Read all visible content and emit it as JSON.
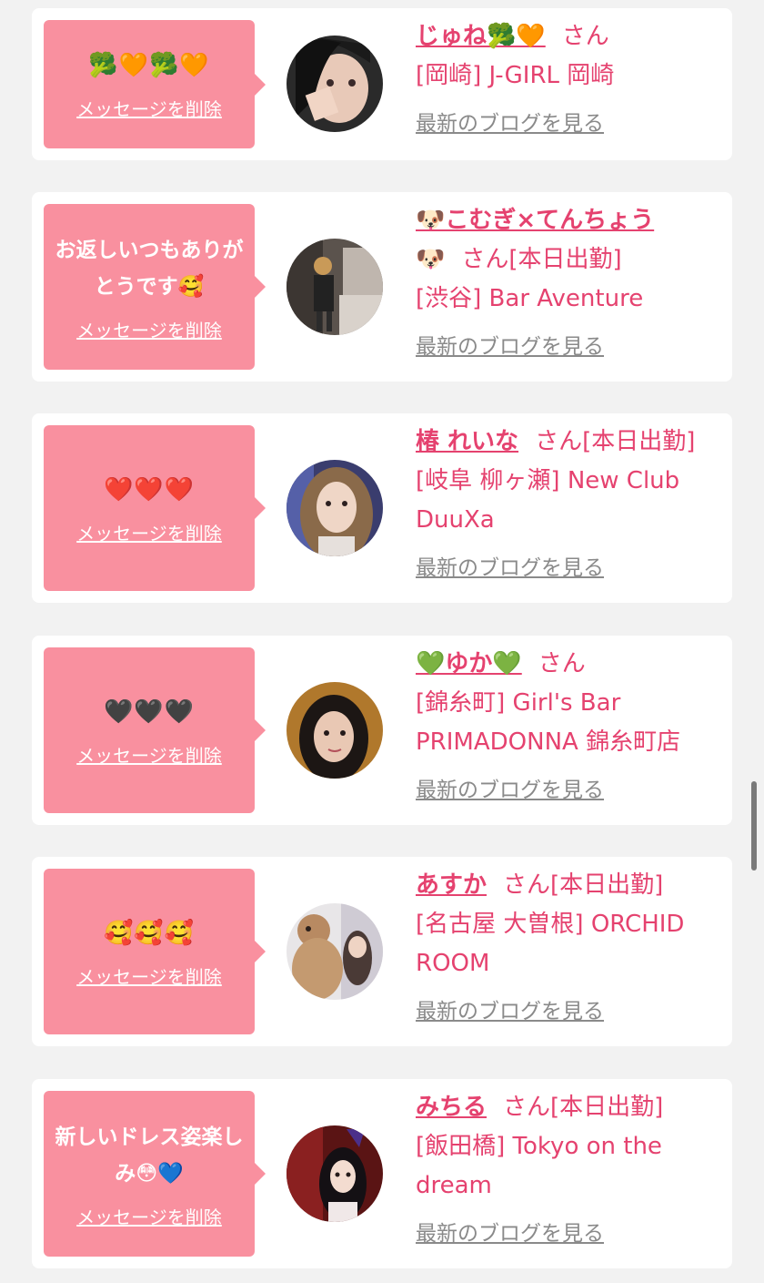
{
  "cards": [
    {
      "message": "🥦🧡🥦🧡",
      "delete_label": "メッセージを削除",
      "name": "じゅね🥦🧡",
      "suffix": "さん",
      "shop": "[岡崎] J-GIRL 岡崎",
      "blog_label": "最新のブログを見る",
      "avatar_icon": "avatar-photo"
    },
    {
      "message": "お返しいつもありがとうです🥰",
      "delete_label": "メッセージを削除",
      "name": "🐶こむぎ×てんちょう",
      "name_cont": "🐶",
      "suffix": "さん[本日出勤]",
      "shop": "[渋谷] Bar Aventure",
      "blog_label": "最新のブログを見る",
      "avatar_icon": "avatar-photo"
    },
    {
      "message": "❤️❤️❤️",
      "delete_label": "メッセージを削除",
      "name": "椿 れいな",
      "suffix": "さん[本日出勤]",
      "shop": "[岐阜 柳ヶ瀬] New Club DuuXa",
      "blog_label": "最新のブログを見る",
      "avatar_icon": "avatar-photo"
    },
    {
      "message": "🖤🖤🖤",
      "delete_label": "メッセージを削除",
      "name": "💚ゆか💚",
      "suffix": "さん",
      "shop": "[錦糸町] Girl's Bar PRIMADONNA 錦糸町店",
      "blog_label": "最新のブログを見る",
      "avatar_icon": "avatar-photo"
    },
    {
      "message": "🥰🥰🥰",
      "delete_label": "メッセージを削除",
      "name": "あすか",
      "suffix": "さん[本日出勤]",
      "shop": "[名古屋 大曽根] ORCHID ROOM",
      "blog_label": "最新のブログを見る",
      "avatar_icon": "avatar-photo"
    },
    {
      "message": "新しいドレス姿楽しみ😳💙",
      "delete_label": "メッセージを削除",
      "name": "みちる",
      "suffix": "さん[本日出勤]",
      "shop": "[飯田橋] Tokyo on the dream",
      "blog_label": "最新のブログを見る",
      "avatar_icon": "avatar-photo"
    }
  ],
  "colors": {
    "accent": "#e5426f",
    "bubble": "#f9909f",
    "link_gray": "#8a8a8a",
    "background": "#f2f2f2"
  }
}
